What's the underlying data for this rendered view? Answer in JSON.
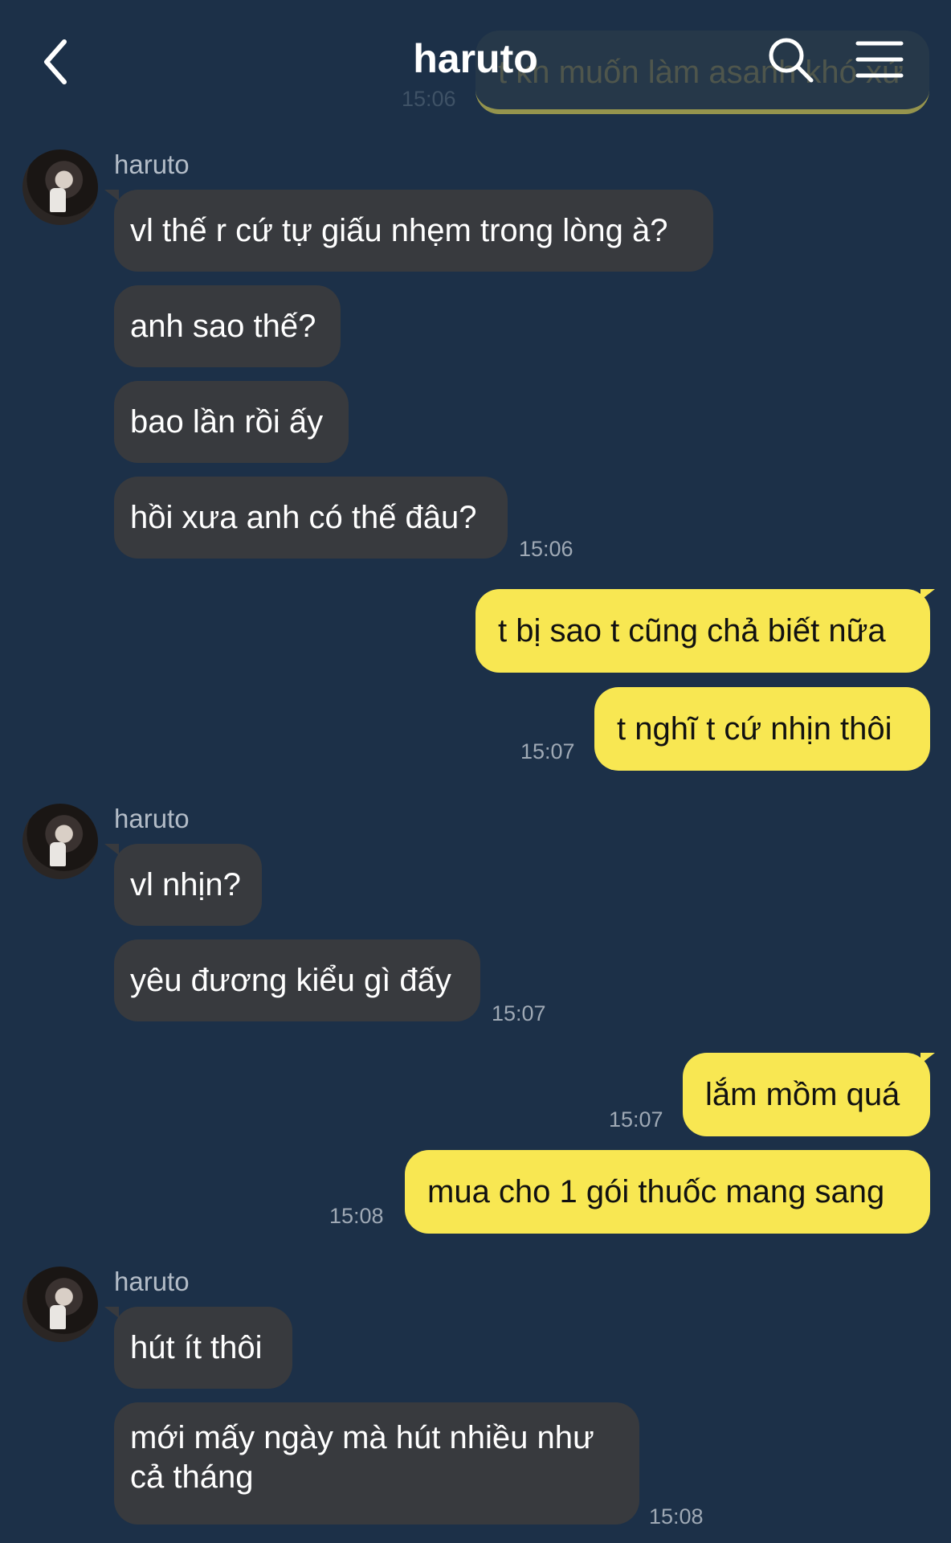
{
  "header": {
    "title": "haruto",
    "back_icon": "chevron-left-icon",
    "search_icon": "search-icon",
    "menu_icon": "menu-icon",
    "ghost_message": "t kh muốn làm asanh khó xử",
    "ghost_time": "15:06"
  },
  "colors": {
    "background": "#1c3048",
    "incoming_bubble": "#383a3e",
    "outgoing_bubble": "#f8e752",
    "timestamp": "#9fa9b5"
  },
  "messages": {
    "g1": {
      "sender": "haruto",
      "m1": "vl thế r cứ tự giấu nhẹm trong lòng à?",
      "m2": "anh sao thế?",
      "m3": "bao lần rồi ấy",
      "m4": "hồi xưa anh có thế đâu?",
      "time": "15:06"
    },
    "o1": {
      "m1": "t bị sao t cũng chả biết nữa",
      "m2": "t nghĩ t cứ nhịn thôi",
      "time": "15:07"
    },
    "g2": {
      "sender": "haruto",
      "m1": "vl nhịn?",
      "m2": "yêu đương kiểu gì đấy",
      "time": "15:07"
    },
    "o2": {
      "m1": "lắm mồm quá",
      "time1": "15:07",
      "m2": "mua cho 1 gói thuốc mang sang",
      "time2": "15:08"
    },
    "g3": {
      "sender": "haruto",
      "m1": "hút ít thôi",
      "m2": "mới mấy ngày mà hút nhiều như cả tháng",
      "time": "15:08"
    }
  }
}
